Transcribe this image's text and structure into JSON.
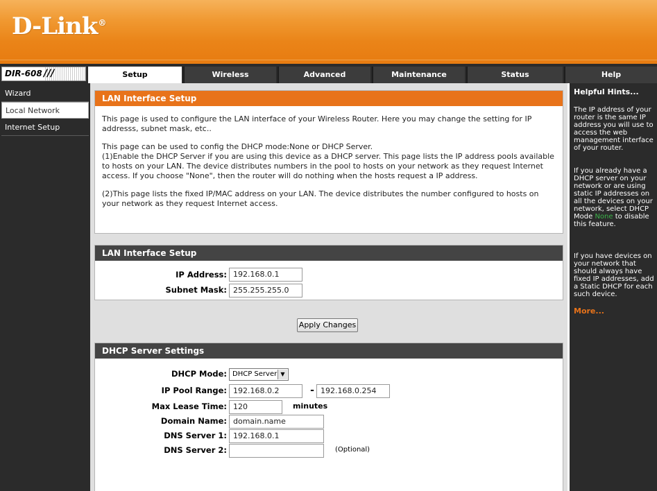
{
  "brand": {
    "logo": "D-Link",
    "reg_mark": "®",
    "model": "DIR-608",
    "model_slashes": "///"
  },
  "tabs": [
    {
      "label": "Setup"
    },
    {
      "label": "Wireless"
    },
    {
      "label": "Advanced"
    },
    {
      "label": "Maintenance"
    },
    {
      "label": "Status"
    },
    {
      "label": "Help"
    }
  ],
  "sidebar": {
    "items": [
      {
        "label": "Wizard"
      },
      {
        "label": "Local Network"
      },
      {
        "label": "Internet Setup"
      }
    ]
  },
  "intro": {
    "title": "LAN Interface Setup",
    "p1": "This page is used to configure the LAN interface of your Wireless Router. Here you may change the setting for IP addresss, subnet mask, etc..",
    "p2": "This page can be used to config the DHCP mode:None or DHCP Server.",
    "p3": "(1)Enable the DHCP Server if you are using this device as a DHCP server. This page lists the IP address pools available to hosts on your LAN. The device distributes numbers in the pool to hosts on your network as they request Internet access. If you choose \"None\", then the router will do nothing when the hosts request a IP address.",
    "p4": "(2)This page lists the fixed IP/MAC address on your LAN. The device distributes the number configured to hosts on your network as they request Internet access."
  },
  "lan": {
    "title": "LAN Interface Setup",
    "ip_label": "IP Address:",
    "ip_value": "192.168.0.1",
    "mask_label": "Subnet Mask:",
    "mask_value": "255.255.255.0"
  },
  "apply_label": "Apply Changes",
  "dhcp": {
    "title": "DHCP Server Settings",
    "mode_label": "DHCP Mode:",
    "mode_value": "DHCP Server",
    "pool_label": "IP Pool Range:",
    "pool_start": "192.168.0.2",
    "pool_sep": "-",
    "pool_end": "192.168.0.254",
    "lease_label": "Max Lease Time:",
    "lease_value": "120",
    "lease_unit": "minutes",
    "domain_label": "Domain Name:",
    "domain_value": "domain.name",
    "dns1_label": "DNS Server 1:",
    "dns1_value": "192.168.0.1",
    "dns2_label": "DNS Server 2:",
    "dns2_value": "",
    "dns2_note": "(Optional)"
  },
  "hints": {
    "title": "Helpful Hints...",
    "p1": "The IP address of your router is the same IP address you will use to access the web management interface of your router.",
    "p2_before": "If you already have a DHCP server on your network or are using static IP addresses on all the devices on your network, select DHCP Mode ",
    "p2_green": "None",
    "p2_after": " to disable this feature.",
    "p3": "If you have devices on your network that should always have fixed IP addresses, add a Static DHCP for each such device.",
    "more": "More..."
  },
  "colors": {
    "accent": "#e8731a",
    "dark": "#2b2b2b",
    "hint_green": "#3cb34a"
  }
}
